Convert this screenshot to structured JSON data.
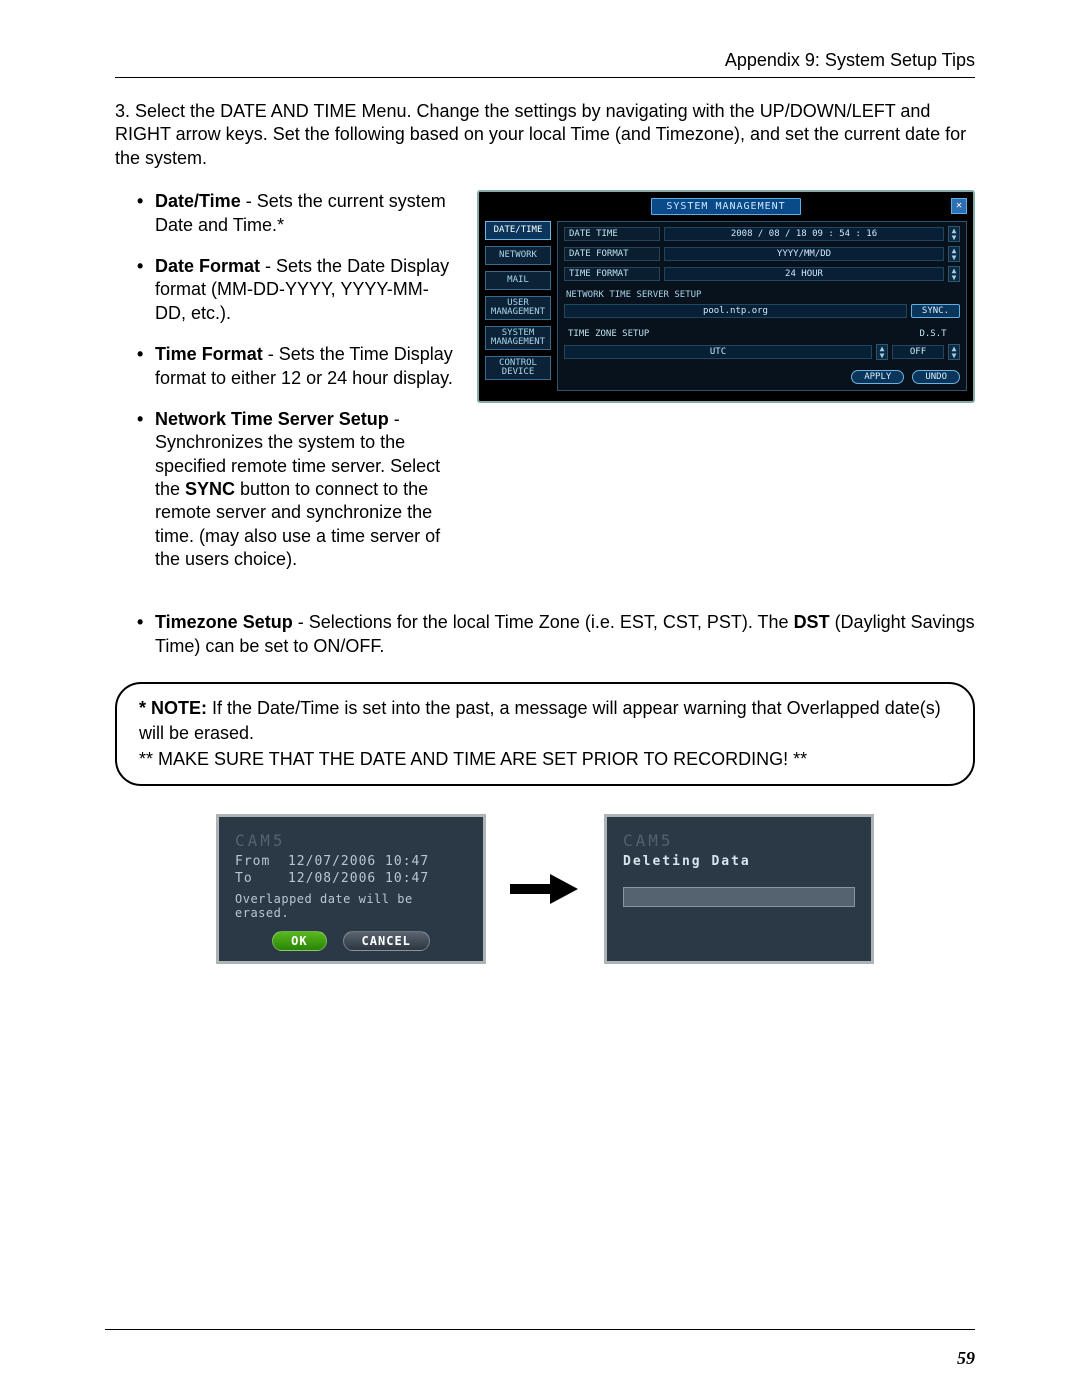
{
  "header": {
    "title": "Appendix 9: System Setup Tips"
  },
  "step": {
    "num": "3.",
    "text": "Select the DATE AND TIME Menu. Change the settings by navigating with the UP/DOWN/LEFT and RIGHT arrow keys. Set the following based on your local Time (and Timezone), and set the current date for the system."
  },
  "bullets": [
    {
      "label": "Date/Time",
      "text": " - Sets the current system Date and Time.*"
    },
    {
      "label": "Date Format",
      "text": " - Sets the Date Display format (MM-DD-YYYY, YYYY-MM-DD, etc.)."
    },
    {
      "label": "Time Format",
      "text": " - Sets the Time Display format to either 12 or 24 hour display."
    },
    {
      "label": "Network Time Server Setup",
      "text_pre": " - Synchronizes the system to the specified remote time server. Select the ",
      "sync": "SYNC",
      "text_post": " button to connect to the remote server and synchronize the time. (may also use a time server of the users choice)."
    }
  ],
  "wide_bullet": {
    "label": "Timezone Setup",
    "text_pre": " - Selections for the local Time Zone (i.e. EST, CST, PST). The ",
    "dst": "DST",
    "text_post": " (Daylight Savings Time) can be set to ON/OFF."
  },
  "screenshot": {
    "title": "SYSTEM MANAGEMENT",
    "tabs": [
      "DATE/TIME",
      "NETWORK",
      "MAIL",
      "USER\nMANAGEMENT",
      "SYSTEM\nMANAGEMENT",
      "CONTROL\nDEVICE"
    ],
    "rows": {
      "date_time_lbl": "DATE TIME",
      "date_time_val": "2008 / 08 / 18  09 : 54 : 16",
      "date_format_lbl": "DATE FORMAT",
      "date_format_val": "YYYY/MM/DD",
      "time_format_lbl": "TIME FORMAT",
      "time_format_val": "24 HOUR",
      "nts_lbl": "NETWORK TIME SERVER SETUP",
      "nts_val": "pool.ntp.org",
      "sync": "SYNC.",
      "tz_lbl": "TIME ZONE SETUP",
      "tz_val": "UTC",
      "dst_lbl": "D.S.T",
      "dst_val": "OFF"
    },
    "footer": {
      "apply": "APPLY",
      "undo": "UNDO"
    }
  },
  "note": {
    "line1_pre": "* NOTE:",
    "line1": " If the Date/Time is set into the past, a message will appear warning that Overlapped date(s) will be erased.",
    "line2": "** MAKE SURE THAT THE DATE AND TIME ARE SET PRIOR TO RECORDING! **"
  },
  "sub1": {
    "cap": "CAM5",
    "from_lbl": "From",
    "from": "12/07/2006 10:47",
    "to_lbl": "To",
    "to": "12/08/2006 10:47",
    "msg": "Overlapped date will be erased.",
    "ok": "OK",
    "cancel": "CANCEL"
  },
  "sub2": {
    "cap": "CAM5",
    "msg": "Deleting Data"
  },
  "page_num": "59"
}
